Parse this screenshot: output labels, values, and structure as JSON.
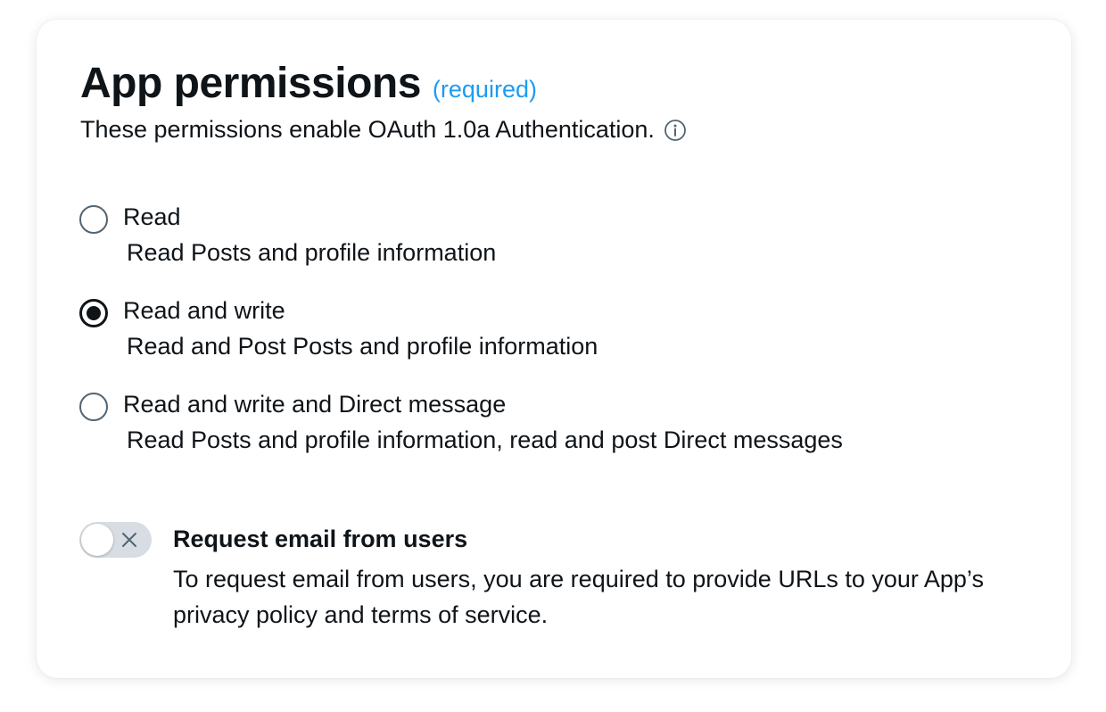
{
  "header": {
    "title": "App permissions",
    "required_label": "(required)",
    "subtitle": "These permissions enable OAuth 1.0a Authentication.",
    "info_icon": "info-circle-icon"
  },
  "permissions": {
    "selected": "Read and write",
    "options": [
      {
        "label": "Read",
        "description": "Read Posts and profile information",
        "checked": false
      },
      {
        "label": "Read and write",
        "description": "Read and Post Posts and profile information",
        "checked": true
      },
      {
        "label": "Read and write and Direct message",
        "description": "Read Posts and profile information, read and post Direct messages",
        "checked": false
      }
    ]
  },
  "email_request": {
    "enabled": false,
    "title": "Request email from users",
    "description": "To request email from users, you are required to provide URLs to your App’s privacy policy and terms of service."
  },
  "colors": {
    "accent": "#1d9bf0",
    "text": "#0f1419",
    "secondary": "#536471",
    "toggle_off": "#d7dde2"
  }
}
